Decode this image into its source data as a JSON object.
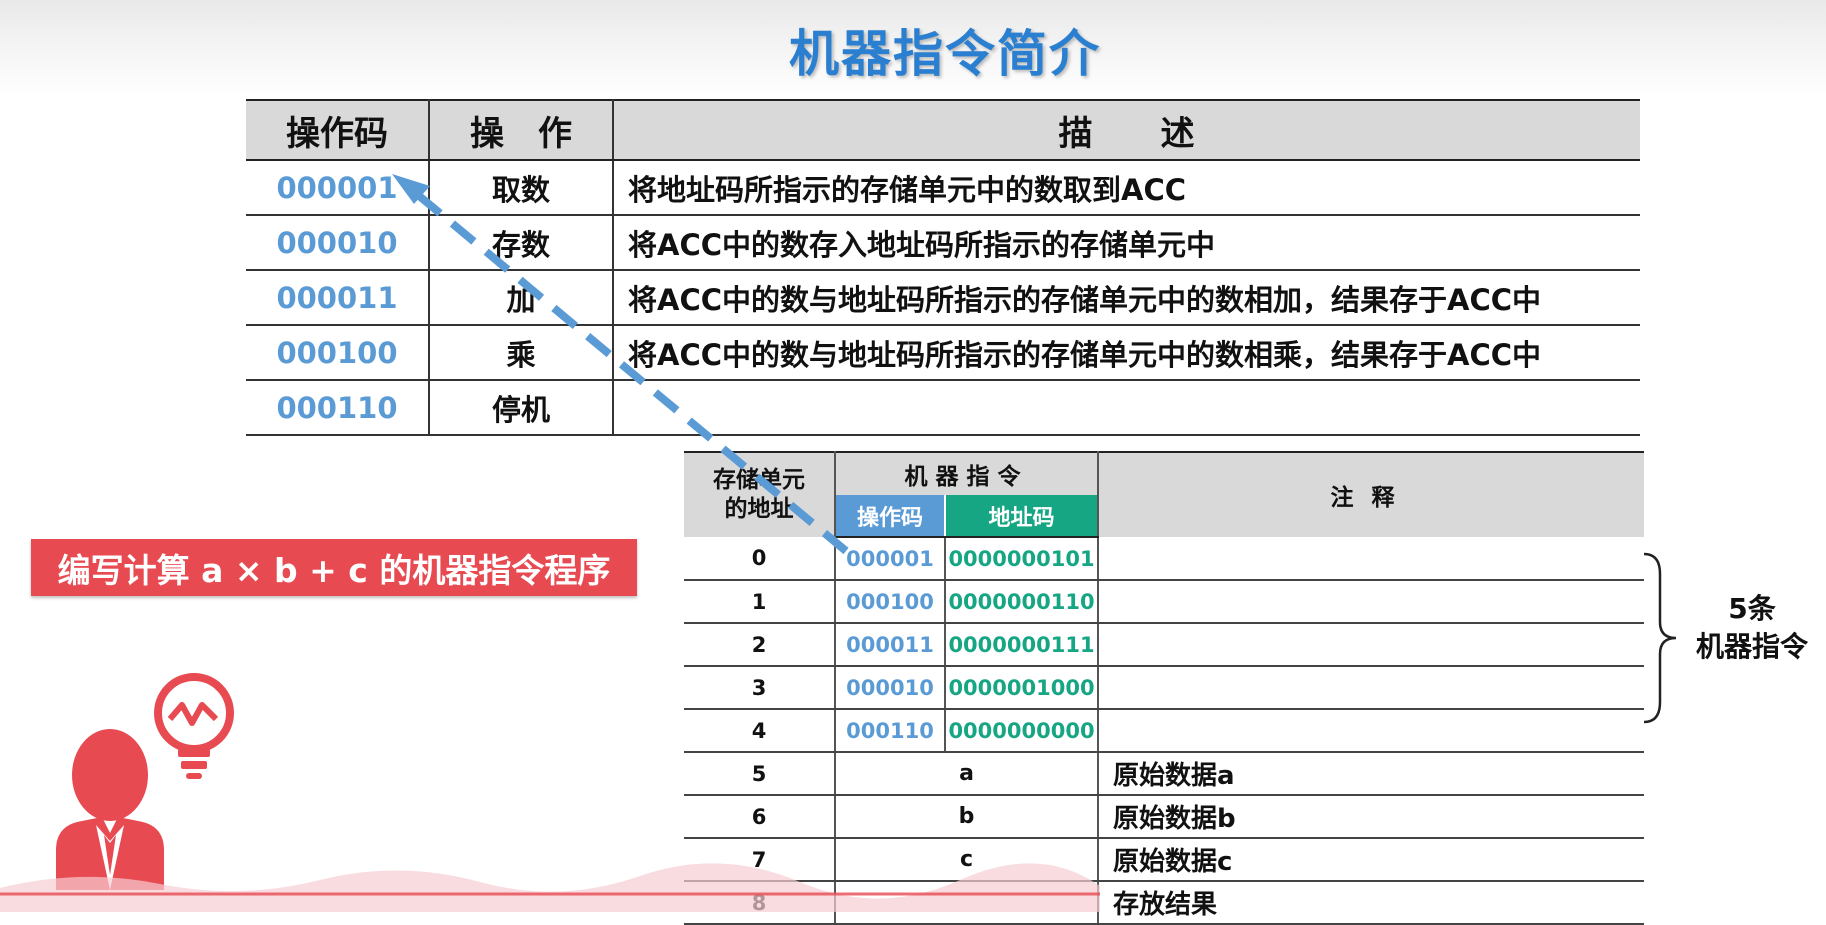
{
  "title": "机器指令简介",
  "top_table": {
    "headers": [
      "操作码",
      "操　作",
      "描　　述"
    ],
    "rows": [
      {
        "opcode": "000001",
        "op": "取数",
        "desc": "将地址码所指示的存储单元中的数取到ACC"
      },
      {
        "opcode": "000010",
        "op": "存数",
        "desc": "将ACC中的数存入地址码所指示的存储单元中"
      },
      {
        "opcode": "000011",
        "op": "加",
        "desc": "将ACC中的数与地址码所指示的存储单元中的数相加，结果存于ACC中"
      },
      {
        "opcode": "000100",
        "op": "乘",
        "desc": "将ACC中的数与地址码所指示的存储单元中的数相乘，结果存于ACC中"
      },
      {
        "opcode": "000110",
        "op": "停机",
        "desc": ""
      }
    ]
  },
  "memory_table": {
    "header_addr": "存储单元\n的地址",
    "header_instr": "机器指令",
    "header_opcode": "操作码",
    "header_address": "地址码",
    "header_note": "注释",
    "instr_rows": [
      {
        "addr": "0",
        "opcode": "000001",
        "address": "0000000101"
      },
      {
        "addr": "1",
        "opcode": "000100",
        "address": "0000000110"
      },
      {
        "addr": "2",
        "opcode": "000011",
        "address": "0000000111"
      },
      {
        "addr": "3",
        "opcode": "000010",
        "address": "0000001000"
      },
      {
        "addr": "4",
        "opcode": "000110",
        "address": "0000000000"
      }
    ],
    "data_rows": [
      {
        "addr": "5",
        "value": "a",
        "note": "原始数据a"
      },
      {
        "addr": "6",
        "value": "b",
        "note": "原始数据b"
      },
      {
        "addr": "7",
        "value": "c",
        "note": "原始数据c"
      },
      {
        "addr": "8",
        "value": "",
        "note": "存放结果"
      }
    ]
  },
  "banner": "编写计算 a × b + c 的机器指令程序",
  "brace_label": {
    "line1": "5条",
    "line2": "机器指令"
  },
  "colors": {
    "title": "#2a7fd0",
    "opcode": "#5b9bd5",
    "address": "#17a683",
    "banner": "#e84a52",
    "figure": "#e84a52"
  },
  "icons": {
    "figure": "person-with-lightbulb-icon",
    "arrow": "dashed-arrow"
  }
}
